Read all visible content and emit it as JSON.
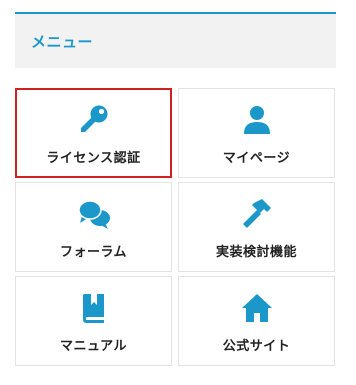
{
  "menu": {
    "title": "メニュー"
  },
  "theme": {
    "accent": "#1b98c9",
    "selected_border": "#cc2222"
  },
  "tiles": [
    {
      "label": "ライセンス認証",
      "icon": "key-icon",
      "selected": true
    },
    {
      "label": "マイページ",
      "icon": "user-icon",
      "selected": false
    },
    {
      "label": "フォーラム",
      "icon": "chat-bubbles-icon",
      "selected": false
    },
    {
      "label": "実装検討機能",
      "icon": "hammer-icon",
      "selected": false
    },
    {
      "label": "マニュアル",
      "icon": "book-icon",
      "selected": false
    },
    {
      "label": "公式サイト",
      "icon": "home-icon",
      "selected": false
    }
  ]
}
